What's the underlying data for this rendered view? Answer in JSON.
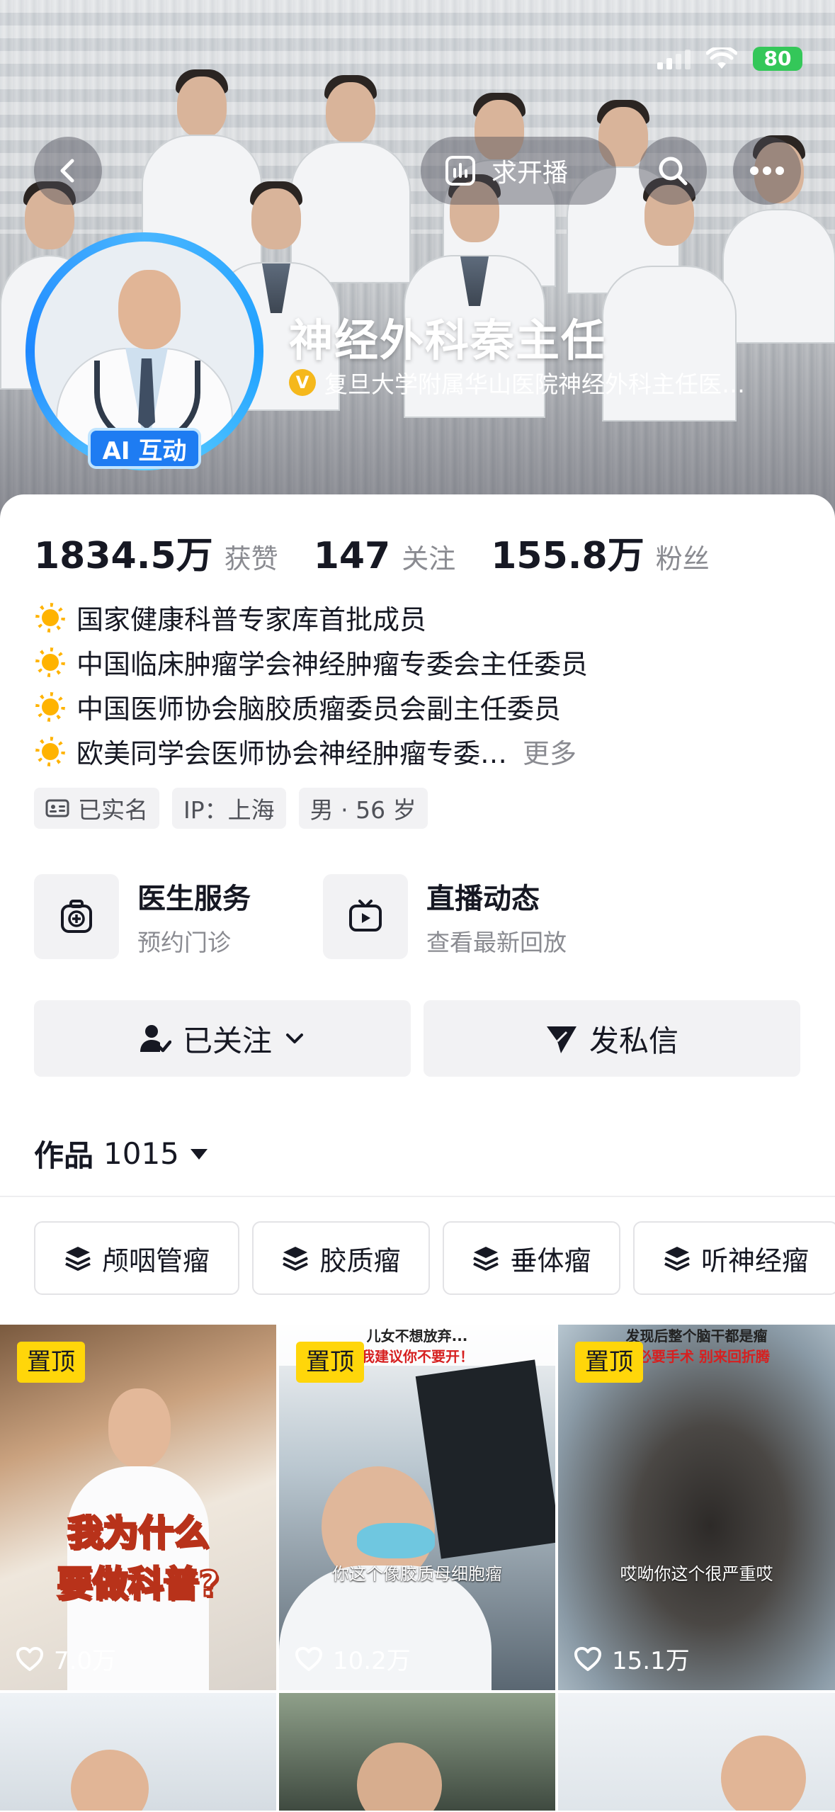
{
  "status": {
    "battery": "80"
  },
  "header": {
    "live_request_label": "求开播",
    "name": "神经外科秦主任",
    "verification": "复旦大学附属华山医院神经外科主任医…",
    "ai_badge": "AI 互动"
  },
  "stats": [
    {
      "value": "1834.5万",
      "label": "获赞"
    },
    {
      "value": "147",
      "label": "关注"
    },
    {
      "value": "155.8万",
      "label": "粉丝"
    }
  ],
  "bio": [
    "国家健康科普专家库首批成员",
    "中国临床肿瘤学会神经肿瘤专委会主任委员",
    "中国医师协会脑胶质瘤委员会副主任委员",
    "欧美同学会医师协会神经肿瘤专委…"
  ],
  "bio_more": "更多",
  "tags": {
    "real_name": "已实名",
    "ip": "IP：上海",
    "gender_age": "男 · 56 岁"
  },
  "services": [
    {
      "title": "医生服务",
      "subtitle": "预约门诊"
    },
    {
      "title": "直播动态",
      "subtitle": "查看最新回放"
    }
  ],
  "actions": {
    "followed": "已关注",
    "message": "发私信"
  },
  "works": {
    "label": "作品",
    "count": "1015"
  },
  "collections": [
    "颅咽管瘤",
    "胶质瘤",
    "垂体瘤",
    "听神经瘤"
  ],
  "videos": [
    {
      "pinned": "置顶",
      "likes": "7.0万",
      "caption_line1": "我为什么",
      "caption_line2": "要做科普?"
    },
    {
      "pinned": "置顶",
      "likes": "10.2万",
      "top_line1": "儿女不想放弃...",
      "top_line2": "我建议你不要开！",
      "caption": "你这个像胶质母细胞瘤"
    },
    {
      "pinned": "置顶",
      "likes": "15.1万",
      "top_line1": "发现后整个脑干都是瘤",
      "top_line2": "没必要手术 别来回折腾",
      "caption": "哎呦你这个很严重哎"
    }
  ],
  "colors": {
    "accent_yellow": "#ffd60a",
    "avatar_ring": "#1fa0ff",
    "verify_gold": "#f5b81c",
    "battery_green": "#34c759"
  }
}
